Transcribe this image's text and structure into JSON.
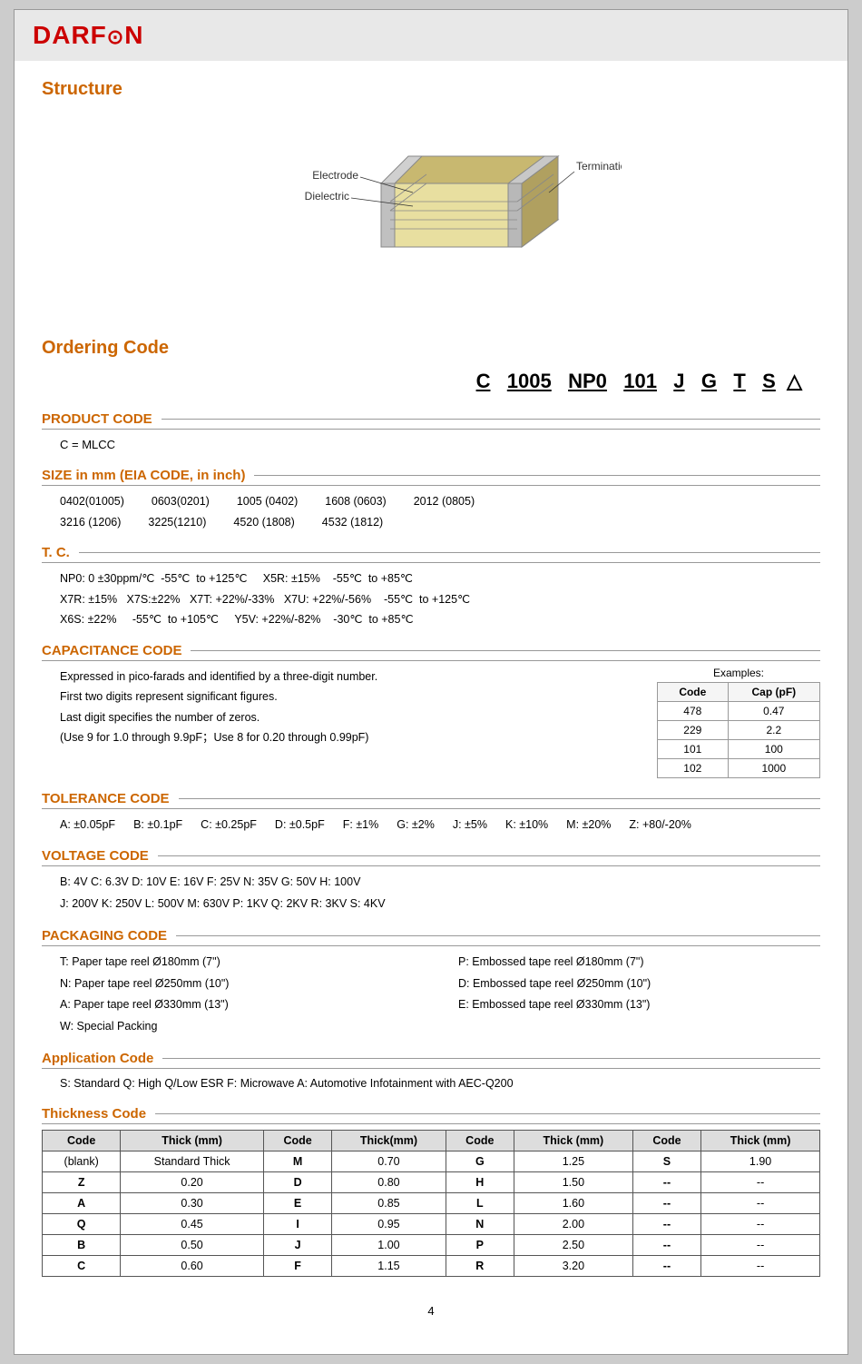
{
  "logo": {
    "text": "DARF",
    "symbol": "⊙",
    "suffix": "N"
  },
  "structure": {
    "title": "Structure",
    "diagram": {
      "electrode_label": "Electrode",
      "dielectric_label": "Dielectric",
      "termination_label": "Termination"
    }
  },
  "ordering": {
    "title": "Ordering Code",
    "code_display": "C 1005 NP0 101 J G T S △",
    "product_code": {
      "title": "PRODUCT CODE",
      "line": "C  =  MLCC"
    },
    "size": {
      "title": "SIZE in mm (EIA CODE, in inch)",
      "values": [
        "0402(01005)",
        "0603(0201)",
        "1005 (0402)",
        "1608 (0603)",
        "2012 (0805)",
        "3216 (1206)",
        "3225(1210)",
        "4520 (1808)",
        "4532 (1812)",
        ""
      ]
    },
    "tc": {
      "title": "T. C.",
      "lines": [
        "NP0: 0 ±30ppm/℃   -55℃  to +125℃     X5R: ±15%    -55℃  to +85℃",
        "X7R: ±15%   X7S:±22%   X7T: +22%/-33%   X7U: +22%/-56%    -55℃  to +125℃",
        "X6S: ±22%     -55℃  to +105℃     Y5V: +22%/-82%    -30℃  to +85℃"
      ]
    },
    "capacitance": {
      "title": "CAPACITANCE CODE",
      "lines": [
        "Expressed in pico-farads and identified by a three-digit number.",
        "First two digits represent significant figures.",
        "Last digit specifies the number of zeros.",
        "(Use 9 for 1.0 through 9.9pF；Use 8 for 0.20 through 0.99pF)"
      ],
      "examples_label": "Examples:",
      "table": {
        "headers": [
          "Code",
          "Cap (pF)"
        ],
        "rows": [
          [
            "478",
            "0.47"
          ],
          [
            "229",
            "2.2"
          ],
          [
            "101",
            "100"
          ],
          [
            "102",
            "1000"
          ]
        ]
      }
    },
    "tolerance": {
      "title": "TOLERANCE CODE",
      "items": [
        "A: ±0.05pF",
        "B: ±0.1pF",
        "C: ±0.25pF",
        "D: ±0.5pF",
        "F: ±1%",
        "G: ±2%",
        "J: ±5%",
        "K: ±10%",
        "M: ±20%",
        "Z: +80/-20%"
      ]
    },
    "voltage": {
      "title": "VOLTAGE CODE",
      "line1": "B: 4V    C: 6.3V    D: 10V   E: 16V    F: 25V    N: 35V    G: 50V    H: 100V",
      "line2": "J: 200V   K: 250V   L: 500V   M: 630V    P: 1KV    Q: 2KV    R: 3KV    S: 4KV"
    },
    "packaging": {
      "title": "PACKAGING CODE",
      "left": [
        "T: Paper tape reel Ø180mm (7\")",
        "N: Paper tape reel Ø250mm (10\")",
        "A: Paper tape reel Ø330mm (13\")",
        "W: Special Packing"
      ],
      "right": [
        "P: Embossed tape reel Ø180mm (7\")",
        "D: Embossed tape reel Ø250mm (10\")",
        "E: Embossed tape reel Ø330mm (13\")"
      ]
    },
    "application": {
      "title": "Application Code",
      "line": "S: Standard   Q: High Q/Low ESR   F: Microwave A: Automotive Infotainment with AEC-Q200"
    },
    "thickness": {
      "title": "Thickness Code",
      "table": {
        "headers": [
          "Code",
          "Thick (mm)",
          "Code",
          "Thick(mm)",
          "Code",
          "Thick (mm)",
          "Code",
          "Thick (mm)"
        ],
        "rows": [
          [
            "(blank)",
            "Standard Thick",
            "M",
            "0.70",
            "G",
            "1.25",
            "S",
            "1.90"
          ],
          [
            "Z",
            "0.20",
            "D",
            "0.80",
            "H",
            "1.50",
            "--",
            "--"
          ],
          [
            "A",
            "0.30",
            "E",
            "0.85",
            "L",
            "1.60",
            "--",
            "--"
          ],
          [
            "Q",
            "0.45",
            "I",
            "0.95",
            "N",
            "2.00",
            "--",
            "--"
          ],
          [
            "B",
            "0.50",
            "J",
            "1.00",
            "P",
            "2.50",
            "--",
            "--"
          ],
          [
            "C",
            "0.60",
            "F",
            "1.15",
            "R",
            "3.20",
            "--",
            "--"
          ]
        ]
      }
    }
  },
  "page_number": "4"
}
